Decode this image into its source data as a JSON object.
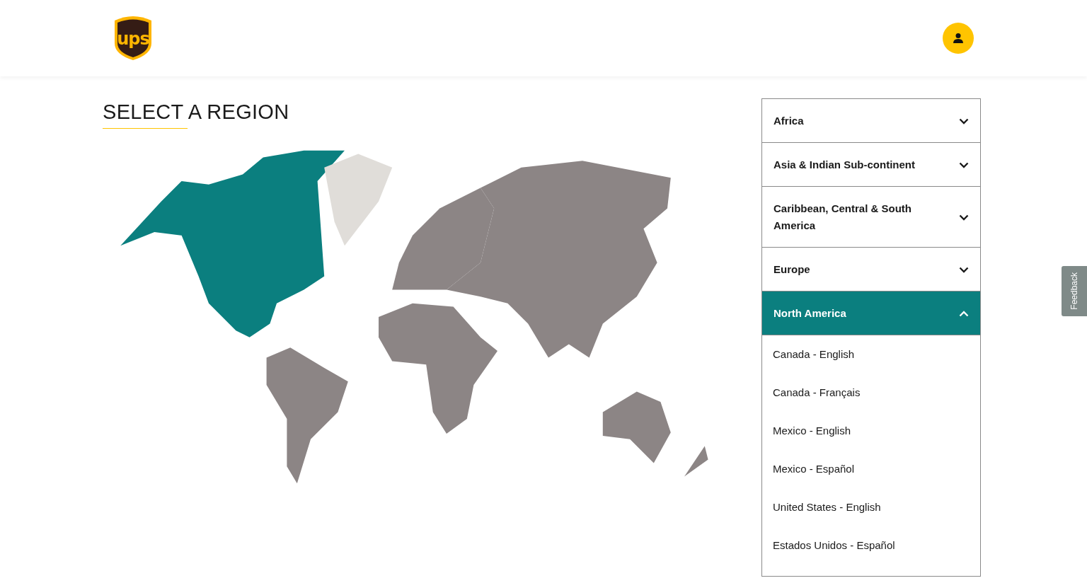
{
  "header": {
    "logo": "ups"
  },
  "title": "SELECT A REGION",
  "regions": [
    {
      "name": "Africa",
      "expanded": false
    },
    {
      "name": "Asia & Indian Sub-continent",
      "expanded": false
    },
    {
      "name": "Caribbean, Central & South America",
      "expanded": false
    },
    {
      "name": "Europe",
      "expanded": false
    },
    {
      "name": "North America",
      "expanded": true,
      "options": [
        "Canada - English",
        "Canada - Français",
        "Mexico - English",
        "Mexico - Español",
        "United States - English",
        "Estados Unidos - Español"
      ]
    }
  ],
  "feedback": "Feedback"
}
